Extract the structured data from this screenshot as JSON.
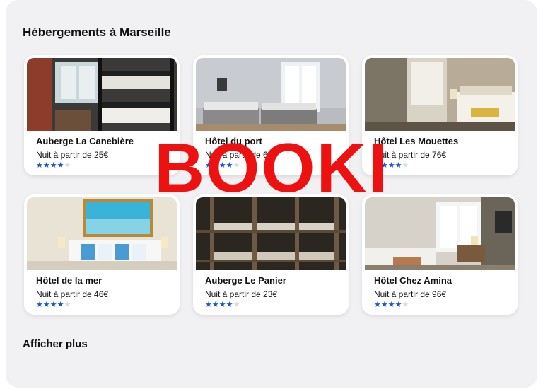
{
  "section": {
    "title": "Hébergements à Marseille"
  },
  "listings": [
    {
      "name": "Auberge La Canebière",
      "price": "Nuit à partir de 25€",
      "rating": 4,
      "max_rating": 5
    },
    {
      "name": "Hôtel du port",
      "price": "Nuit à partir de 62€",
      "rating": 4,
      "max_rating": 5
    },
    {
      "name": "Hôtel Les Mouettes",
      "price": "Nuit à partir de 76€",
      "rating": 4,
      "max_rating": 5
    },
    {
      "name": "Hôtel de la mer",
      "price": "Nuit à partir de 46€",
      "rating": 4,
      "max_rating": 5
    },
    {
      "name": "Auberge Le Panier",
      "price": "Nuit à partir de 23€",
      "rating": 4,
      "max_rating": 5
    },
    {
      "name": "Hôtel Chez Amina",
      "price": "Nuit à partir de 96€",
      "rating": 4,
      "max_rating": 5
    }
  ],
  "show_more": {
    "label": "Afficher plus"
  },
  "watermark": {
    "text": "BOOKI"
  },
  "colors": {
    "star_active": "#1b55d0",
    "star_inactive": "#dcdcdc",
    "watermark": "#ee1111",
    "panel_bg": "#f1f1f3"
  }
}
